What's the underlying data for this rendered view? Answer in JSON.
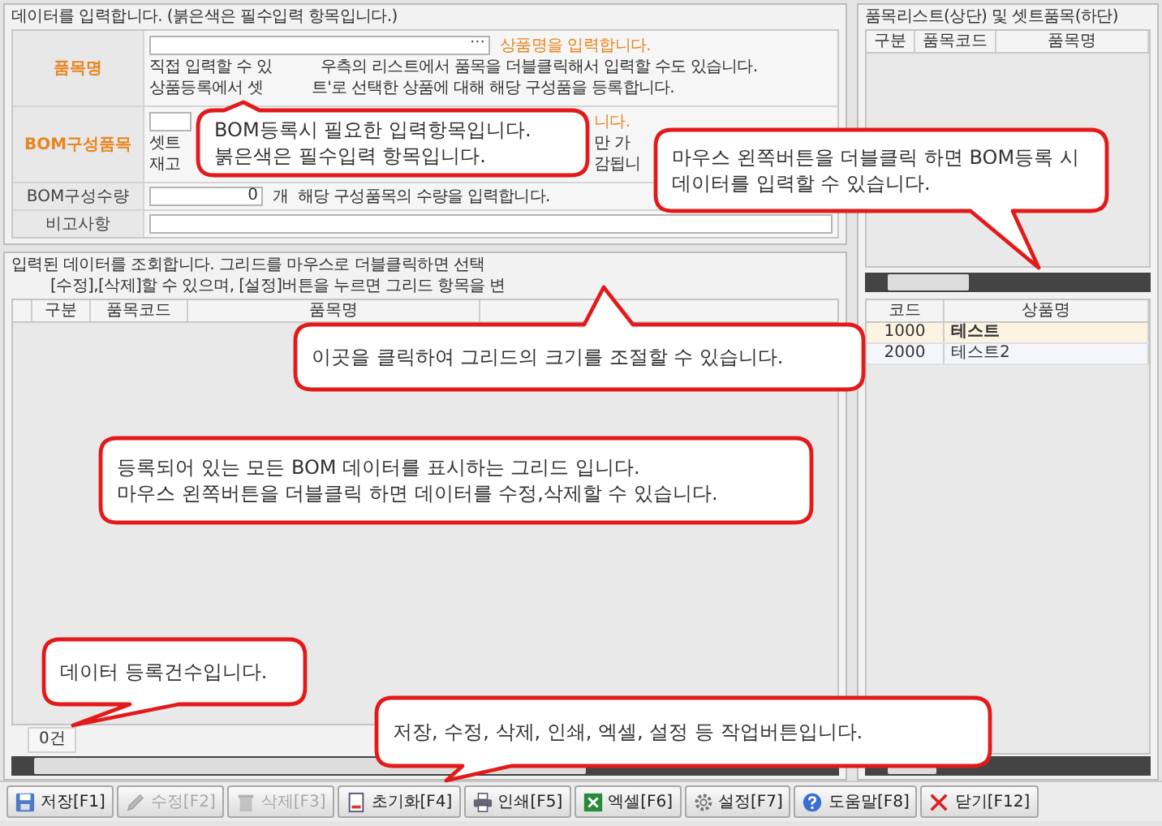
{
  "input_panel": {
    "header": "데이터를 입력합니다. (붉은색은 필수입력 항목입니다.)",
    "rows": [
      {
        "kind": "product",
        "label": "품목명",
        "required": true,
        "hint_button": "···",
        "note": "상품명을 입력합니다.",
        "hint_lines": [
          [
            "직접 입력할 수 있",
            "우측의 리스트에서 품목을 더블클릭해서 입력할 수도 있습니다."
          ],
          [
            "상품등록에서 셋",
            "트'로 선택한 상품에 대해 해당 구성품을 등록합니다."
          ]
        ]
      },
      {
        "kind": "component",
        "label": "BOM구성품목",
        "required": true,
        "note": "니다.",
        "hint_lines": [
          [
            "셋트",
            "만 가"
          ],
          [
            "재고",
            "감됩니"
          ]
        ]
      },
      {
        "kind": "quantity",
        "label": "BOM구성수량",
        "required": false,
        "value": "0",
        "unit": "개",
        "note": "해당 구성품목의 수량을 입력합니다."
      },
      {
        "kind": "remarks",
        "label": "비고사항",
        "required": false
      }
    ]
  },
  "data_panel": {
    "header": [
      "입력된 데이터를 조회합니다. 그리드를 마우스로 더블클릭하면 선택",
      "[수정],[삭제]할 수 있으며, [설정]버튼을 누르면 그리드 항목을 변"
    ],
    "columns": [
      "구분",
      "품목코드",
      "품목명"
    ],
    "count": "0건"
  },
  "item_panel": {
    "header": "품목리스트(상단) 및 셋트품목(하단)",
    "columns": [
      "구분",
      "품목코드",
      "품목명"
    ],
    "set_columns": [
      "코드",
      "상품명"
    ],
    "set_rows": [
      {
        "code": "1000",
        "name": "테스트",
        "selected": true
      },
      {
        "code": "2000",
        "name": "테스트2",
        "selected": false
      }
    ]
  },
  "toolbar": [
    {
      "kind": "save",
      "label": "저장[F1]",
      "disabled": false
    },
    {
      "kind": "edit",
      "label": "수정[F2]",
      "disabled": true
    },
    {
      "kind": "delete",
      "label": "삭제[F3]",
      "disabled": true
    },
    {
      "kind": "reset",
      "label": "초기화[F4]",
      "disabled": false
    },
    {
      "kind": "print",
      "label": "인쇄[F5]",
      "disabled": false
    },
    {
      "kind": "excel",
      "label": "엑셀[F6]",
      "disabled": false
    },
    {
      "kind": "settings",
      "label": "설정[F7]",
      "disabled": false
    },
    {
      "kind": "help",
      "label": "도움말[F8]",
      "disabled": false
    },
    {
      "kind": "close",
      "label": "닫기[F12]",
      "disabled": false
    }
  ],
  "callouts": [
    {
      "lines": [
        "BOM등록시 필요한 입력항목입니다.",
        "붉은색은 필수입력 항목입니다."
      ]
    },
    {
      "lines": [
        "마우스 왼쪽버튼을 더블클릭 하면 BOM등록 시",
        "데이터를 입력할 수 있습니다."
      ]
    },
    {
      "lines": [
        "이곳을 클릭하여 그리드의 크기를 조절할 수 있습니다."
      ]
    },
    {
      "lines": [
        "등록되어 있는 모든 BOM 데이터를 표시하는 그리드 입니다.",
        "마우스 왼쪽버튼을 더블클릭 하면 데이터를 수정,삭제할 수 있습니다."
      ]
    },
    {
      "lines": [
        "데이터 등록건수입니다."
      ]
    },
    {
      "lines": [
        "저장, 수정, 삭제, 인쇄, 엑셀, 설정 등 작업버튼입니다."
      ]
    }
  ]
}
